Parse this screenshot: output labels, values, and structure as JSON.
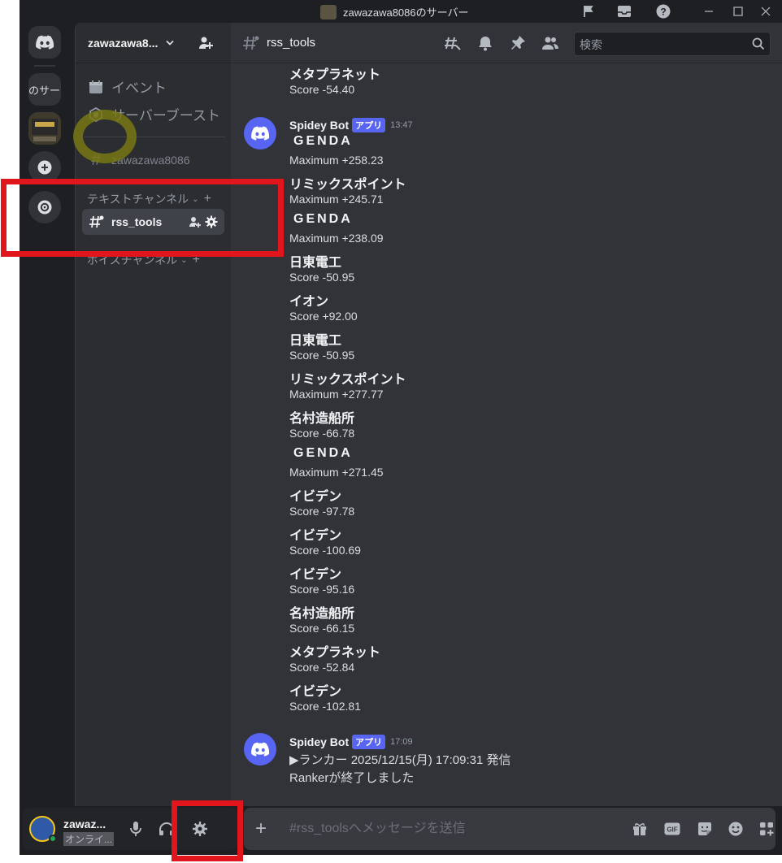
{
  "window": {
    "title": "zawazawa8086のサーバー"
  },
  "rail": {
    "server_label": "のサーバ"
  },
  "sidebar": {
    "server_name": "zawazawa8...",
    "events_label": "イベント",
    "boost_label": "サーバーブースト",
    "welcome_channel": "zawazawa8086",
    "text_category": "テキストチャンネル",
    "active_channel": "rss_tools",
    "voice_category": "ボイスチャンネル"
  },
  "header": {
    "channel_name": "rss_tools",
    "search_placeholder": "検索"
  },
  "messages": {
    "pre": [
      {
        "name": "メタプラネット",
        "value": "Score -54.40"
      }
    ],
    "group1": {
      "author": "Spidey Bot",
      "tag": "アプリ",
      "time": "13:47",
      "entries": [
        {
          "name": "GENDA",
          "value": "Maximum +258.23"
        },
        {
          "name": "リミックスポイント",
          "value": "Maximum +245.71"
        },
        {
          "name": "GENDA",
          "value": "Maximum +238.09"
        },
        {
          "name": "日東電工",
          "value": "Score -50.95"
        },
        {
          "name": "イオン",
          "value": "Score +92.00"
        },
        {
          "name": "日東電工",
          "value": "Score -50.95"
        },
        {
          "name": "リミックスポイント",
          "value": "Maximum +277.77"
        },
        {
          "name": "名村造船所",
          "value": "Score -66.78"
        },
        {
          "name": "GENDA",
          "value": "Maximum +271.45"
        },
        {
          "name": "イビデン",
          "value": "Score -97.78"
        },
        {
          "name": "イビデン",
          "value": "Score -100.69"
        },
        {
          "name": "イビデン",
          "value": "Score -95.16"
        },
        {
          "name": "名村造船所",
          "value": "Score -66.15"
        },
        {
          "name": "メタプラネット",
          "value": "Score -52.84"
        },
        {
          "name": "イビデン",
          "value": "Score -102.81"
        }
      ]
    },
    "group2": {
      "author": "Spidey Bot",
      "tag": "アプリ",
      "time": "17:09",
      "line1": "▶ランカー 2025/12/15(月) 17:09:31 発信",
      "line2": "Rankerが終了しました"
    }
  },
  "composer": {
    "placeholder": "#rss_toolsへメッセージを送信"
  },
  "user": {
    "name": "zawaz...",
    "status": "オンライ..."
  },
  "colors": {
    "accent": "#5865f2",
    "annotation_red": "#e0161c",
    "annotation_olive": "#78781a"
  }
}
